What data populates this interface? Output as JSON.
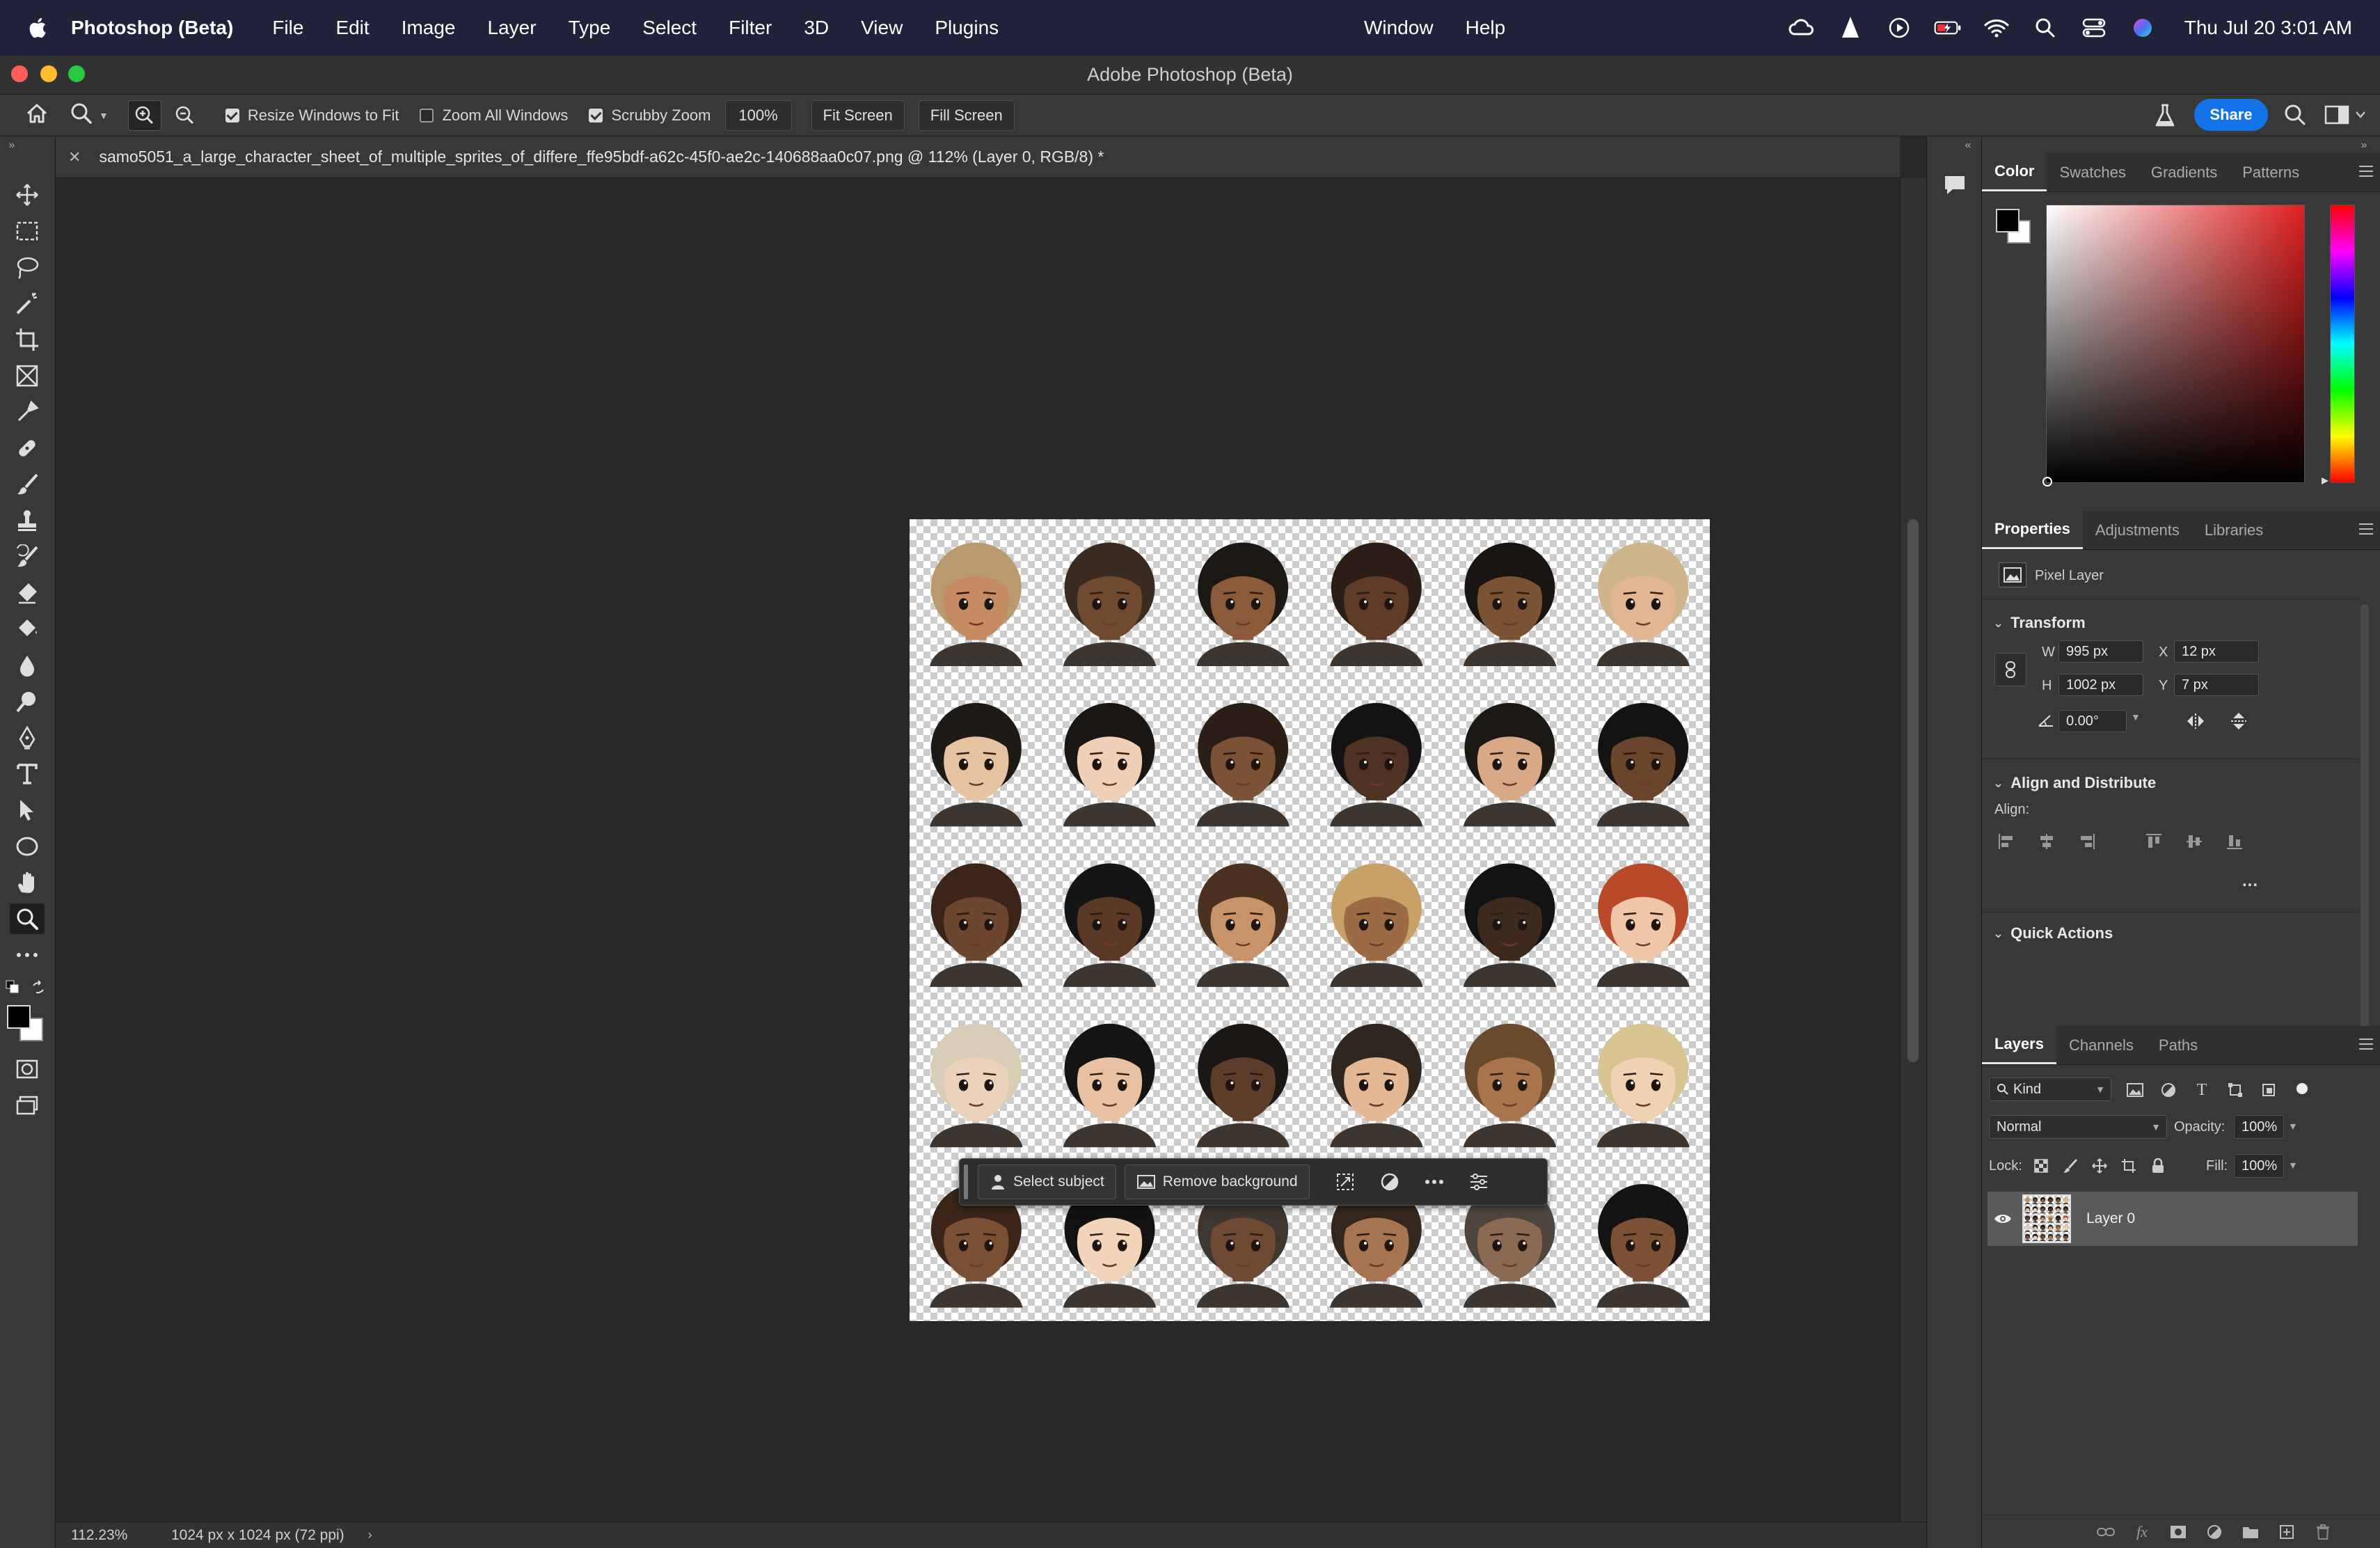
{
  "menubar": {
    "app_name": "Photoshop (Beta)",
    "items": [
      "File",
      "Edit",
      "Image",
      "Layer",
      "Type",
      "Select",
      "Filter",
      "3D",
      "View",
      "Plugins"
    ],
    "right_items": [
      "Window",
      "Help"
    ],
    "clock": "Thu Jul 20  3:01 AM",
    "status_icons": [
      "creative-cloud-icon",
      "vlc-icon",
      "play-icon",
      "battery-icon",
      "wifi-icon",
      "spotlight-icon",
      "control-center-icon",
      "siri-icon"
    ]
  },
  "window": {
    "title": "Adobe Photoshop (Beta)"
  },
  "options": {
    "resize_windows": "Resize Windows to Fit",
    "resize_windows_checked": true,
    "zoom_all": "Zoom All Windows",
    "zoom_all_checked": false,
    "scrubby_zoom": "Scrubby Zoom",
    "scrubby_zoom_checked": true,
    "zoom_value": "100%",
    "fit_screen": "Fit Screen",
    "fill_screen": "Fill Screen",
    "share": "Share"
  },
  "document": {
    "tab_title": "samo5051_a_large_character_sheet_of_multiple_sprites_of_differe_ffe95bdf-a62c-45f0-ae2c-140688aa0c07.png @ 112% (Layer 0, RGB/8) *",
    "zoom": "112.23%",
    "doc_info": "1024 px x 1024 px (72 ppi)",
    "sprite_grid": {
      "rows": 5,
      "cols": 6
    },
    "skin_tones": [
      "#c58c62",
      "#6f4a30",
      "#8a5a3a",
      "#5e3c27",
      "#7a5234",
      "#e2b692",
      "#e6c3a0",
      "#f0cfb7",
      "#7b5236",
      "#4e3322",
      "#d9a987",
      "#6a442b",
      "#6d4630",
      "#5a3a27",
      "#c9936a",
      "#9c6b45",
      "#3e2a1d",
      "#f0c6a8",
      "#ead2bc",
      "#e8c1a3",
      "#5c3d29",
      "#e4b895",
      "#a9744b",
      "#efd2b4",
      "#7a5034",
      "#f1d4ba",
      "#6e4a33",
      "#a77452",
      "#8a6a52",
      "#7b5034"
    ],
    "hair_colors": [
      "#b99a6e",
      "#3b2a1f",
      "#1c1915",
      "#2c1e16",
      "#1a1512",
      "#cdb48a",
      "#1e1a16",
      "#1a1614",
      "#2a1e16",
      "#141212",
      "#1c1814",
      "#141212",
      "#3a2518",
      "#141414",
      "#4b3220",
      "#c9a065",
      "#121212",
      "#b84a2a",
      "#d9cdb8",
      "#141414",
      "#1b1714",
      "#2e261f",
      "#6a4a2c",
      "#d8c490",
      "#3a2518",
      "#121212",
      "#3e3630",
      "#33271e",
      "#4e463e",
      "#141212"
    ]
  },
  "context_bar": {
    "select_subject": "Select subject",
    "remove_background": "Remove background"
  },
  "color_panel": {
    "tabs": [
      "Color",
      "Swatches",
      "Gradients",
      "Patterns"
    ],
    "active_tab": "Color",
    "hue_color": "#e02020"
  },
  "properties_panel": {
    "tabs": [
      "Properties",
      "Adjustments",
      "Libraries"
    ],
    "active_tab": "Properties",
    "layer_type": "Pixel Layer",
    "transform_label": "Transform",
    "w_label": "W",
    "w_value": "995 px",
    "h_label": "H",
    "h_value": "1002 px",
    "x_label": "X",
    "x_value": "12 px",
    "y_label": "Y",
    "y_value": "7 px",
    "angle_value": "0.00°",
    "align_section": "Align and Distribute",
    "align_label": "Align:",
    "more": "...",
    "quick_actions": "Quick Actions"
  },
  "layers_panel": {
    "tabs": [
      "Layers",
      "Channels",
      "Paths"
    ],
    "active_tab": "Layers",
    "filter_kind": "Kind",
    "blend_mode": "Normal",
    "opacity_label": "Opacity:",
    "opacity_value": "100%",
    "lock_label": "Lock:",
    "fill_label": "Fill:",
    "fill_value": "100%",
    "layers": [
      {
        "name": "Layer 0",
        "visible": true
      }
    ]
  },
  "tools": [
    "move-tool",
    "marquee-tool",
    "lasso-tool",
    "magic-wand-tool",
    "crop-tool",
    "frame-tool",
    "eyedropper-tool",
    "healing-brush-tool",
    "brush-tool",
    "clone-stamp-tool",
    "history-brush-tool",
    "eraser-tool",
    "paint-bucket-tool",
    "blur-tool",
    "dodge-tool",
    "pen-tool",
    "type-tool",
    "path-selection-tool",
    "ellipse-tool",
    "hand-tool",
    "zoom-tool",
    "more-tools"
  ]
}
